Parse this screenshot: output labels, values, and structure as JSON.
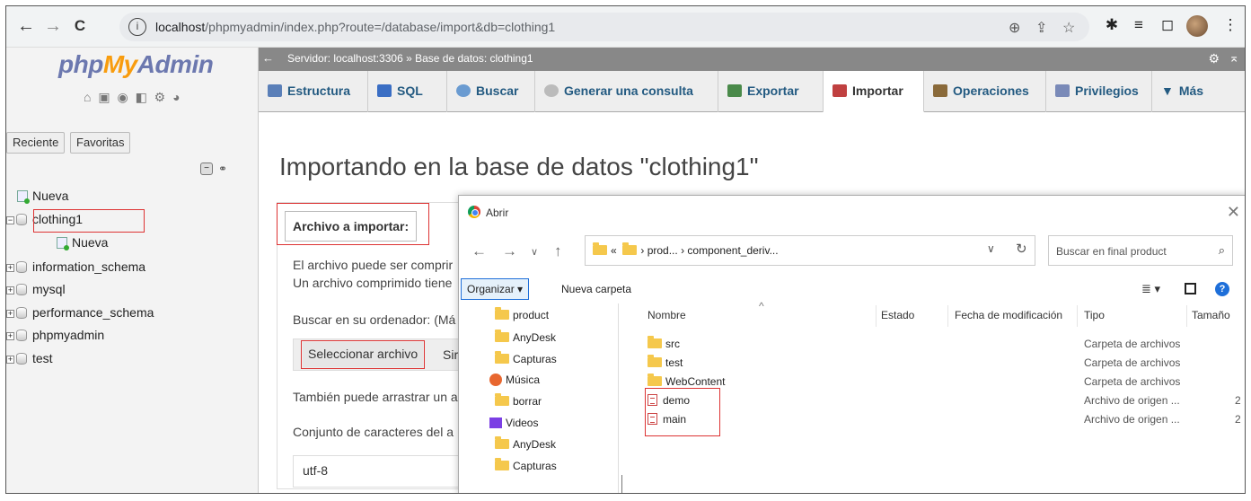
{
  "browser": {
    "back": "←",
    "forward": "→",
    "reload": "C",
    "url_host": "localhost",
    "url_path": "/phpmyadmin/index.php?route=/database/import&db=clothing1"
  },
  "sidebar": {
    "logo_php": "php",
    "logo_my": "My",
    "logo_admin": "Admin",
    "tabs": [
      "Reciente",
      "Favoritas"
    ],
    "tree": [
      {
        "label": "Nueva"
      },
      {
        "label": "clothing1"
      },
      {
        "label": "Nueva"
      },
      {
        "label": "information_schema"
      },
      {
        "label": "mysql"
      },
      {
        "label": "performance_schema"
      },
      {
        "label": "phpmyadmin"
      },
      {
        "label": "test"
      }
    ]
  },
  "breadcrumb": {
    "server": "Servidor: localhost:3306",
    "separator": "»",
    "database": "Base de datos: clothing1"
  },
  "tabs": [
    {
      "label": "Estructura",
      "color": "#5a7fb8"
    },
    {
      "label": "SQL",
      "color": "#3a6ec4"
    },
    {
      "label": "Buscar",
      "color": "#6a9bd1"
    },
    {
      "label": "Generar una consulta",
      "color": "#9aa"
    },
    {
      "label": "Exportar",
      "color": "#4a8a4a"
    },
    {
      "label": "Importar",
      "color": "#c04040"
    },
    {
      "label": "Operaciones",
      "color": "#8a6a3a"
    },
    {
      "label": "Privilegios",
      "color": "#7a8ab8"
    },
    {
      "label": "Más",
      "color": "#333"
    }
  ],
  "main": {
    "title": "Importando en la base de datos \"clothing1\"",
    "legend": "Archivo a importar:",
    "line1": "El archivo puede ser comprir",
    "line2": "Un archivo comprimido tiene",
    "browse_label": "Buscar en su ordenador: (Má",
    "select_file_button": "Seleccionar archivo",
    "no_file_text": "Sir",
    "drag_text": "También puede arrastrar un a",
    "charset_label": "Conjunto de caracteres del a",
    "charset_value": "utf-8"
  },
  "dialog": {
    "title": "Abrir",
    "path_prefix": "«",
    "path_mid": "prod...",
    "path_current": "component_deriv...",
    "search_placeholder": "Buscar en final product",
    "organize": "Organizar ▾",
    "new_folder": "Nueva carpeta",
    "nav_items": [
      {
        "label": "product",
        "icon": "folder"
      },
      {
        "label": "AnyDesk",
        "icon": "folder"
      },
      {
        "label": "Capturas",
        "icon": "folder"
      },
      {
        "label": "Música",
        "icon": "music"
      },
      {
        "label": "borrar",
        "icon": "folder"
      },
      {
        "label": "Videos",
        "icon": "video"
      },
      {
        "label": "AnyDesk",
        "icon": "folder"
      },
      {
        "label": "Capturas",
        "icon": "folder"
      }
    ],
    "columns": [
      "Nombre",
      "Estado",
      "Fecha de modificación",
      "Tipo",
      "Tamaño"
    ],
    "files": [
      {
        "name": "src",
        "type": "Carpeta de archivos",
        "size": "",
        "icon": "folder"
      },
      {
        "name": "test",
        "type": "Carpeta de archivos",
        "size": "",
        "icon": "folder"
      },
      {
        "name": "WebContent",
        "type": "Carpeta de archivos",
        "size": "",
        "icon": "folder"
      },
      {
        "name": "demo",
        "type": "Archivo de origen ...",
        "size": "2",
        "icon": "source-file"
      },
      {
        "name": "main",
        "type": "Archivo de origen ...",
        "size": "2",
        "icon": "source-file"
      }
    ]
  }
}
